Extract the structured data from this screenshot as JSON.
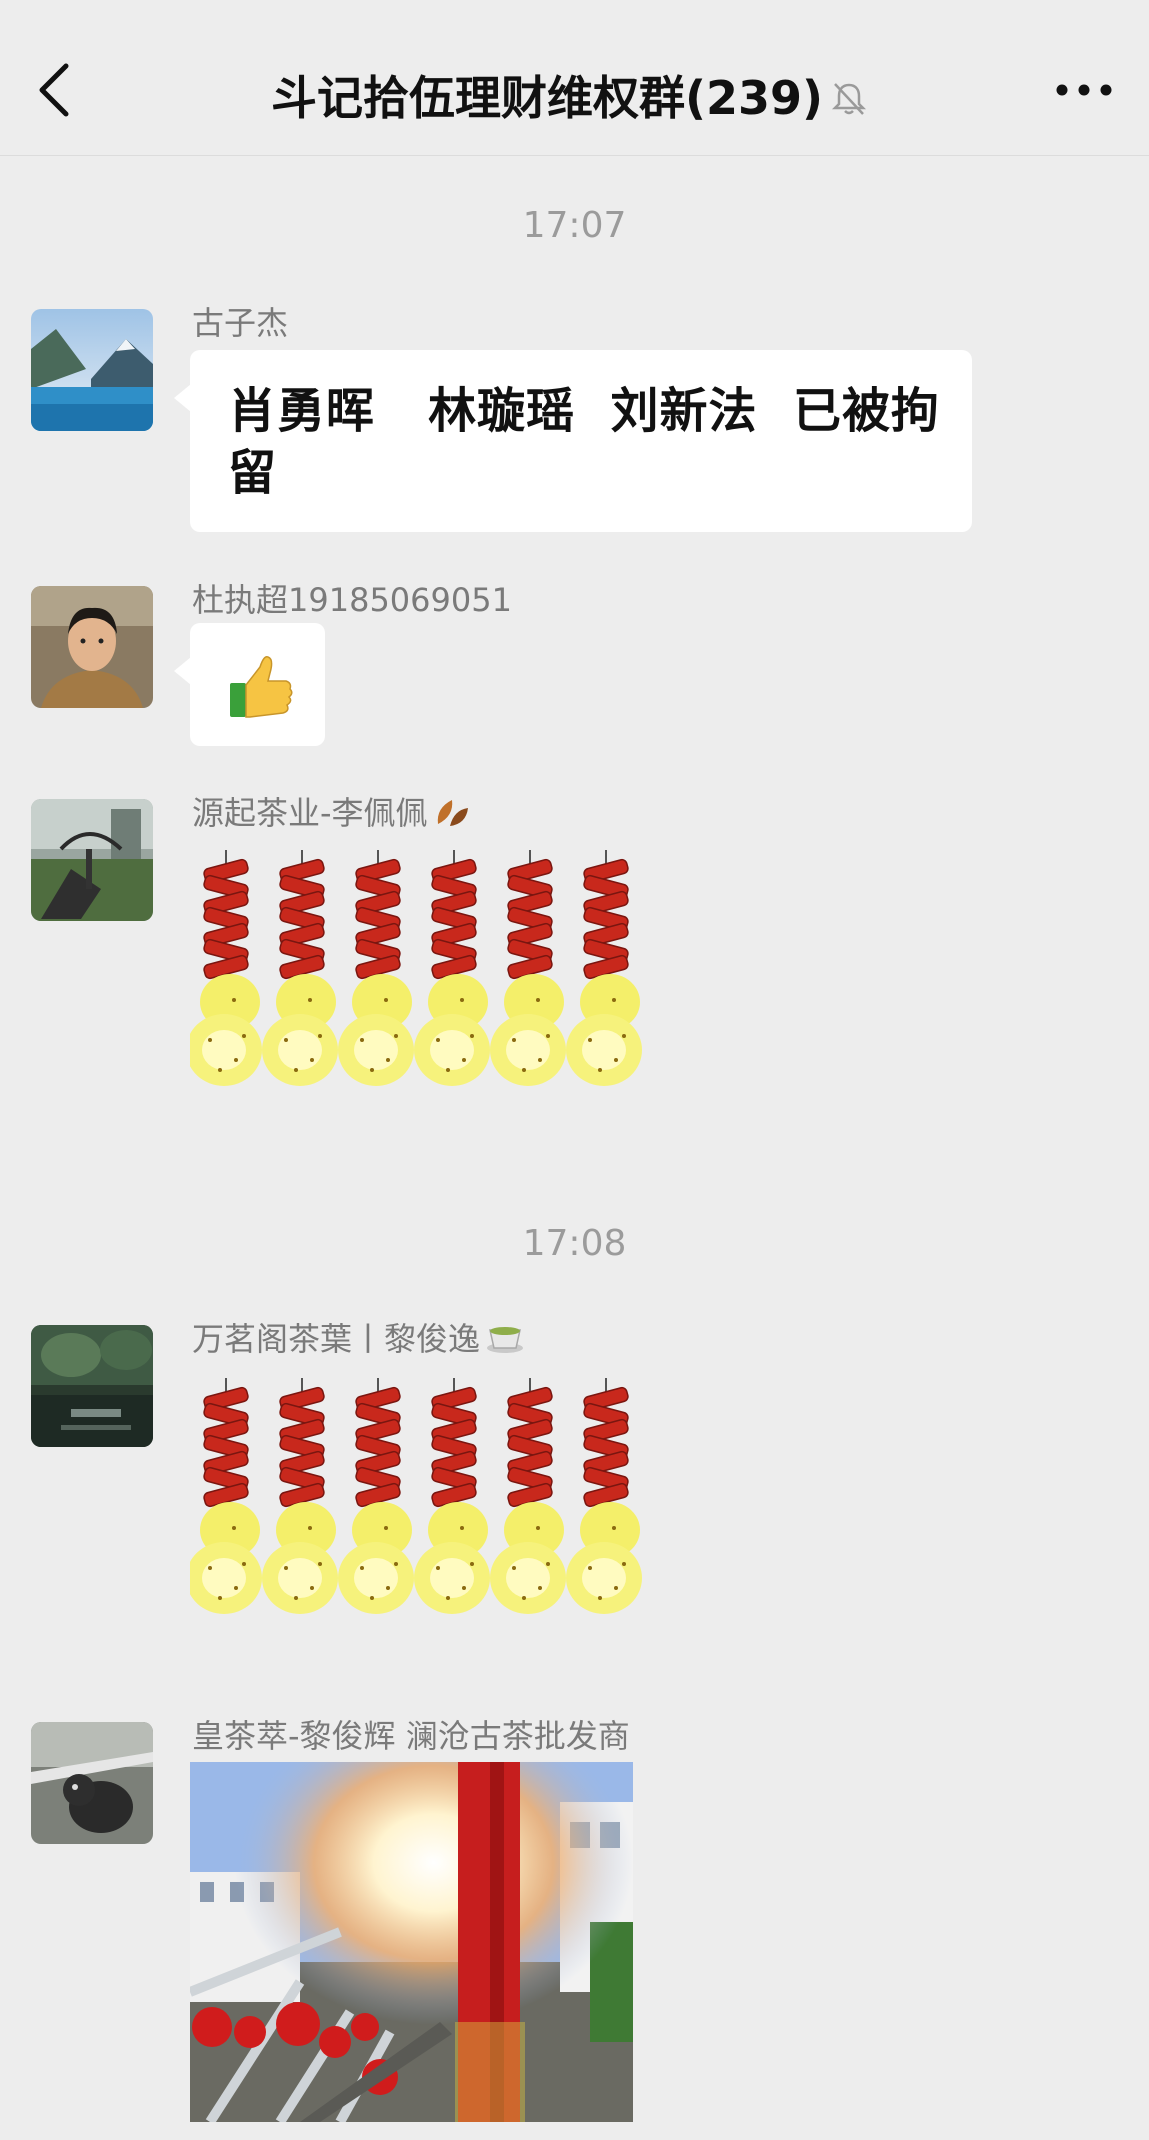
{
  "header": {
    "title": "斗记拾伍理财维权群(239)",
    "back_icon": "chevron-left-icon",
    "mute_icon": "bell-off-icon",
    "more_icon": "more-dots-icon"
  },
  "timestamps": [
    "17:07",
    "17:08"
  ],
  "messages": [
    {
      "sender": "古子杰",
      "text_line1": "肖勇晖   林璇瑶  刘新法  已被拘",
      "text_line2": "留"
    },
    {
      "sender": "杜执超19185069051",
      "emoji": "thumbs-up"
    },
    {
      "sender": "源起茶业-李佩佩",
      "sender_emoji": "fallen-leaves",
      "sticker": "firecrackers"
    },
    {
      "sender": "万茗阁茶葉丨黎俊逸",
      "sender_emoji": "tea-cup",
      "sticker": "firecrackers"
    },
    {
      "sender": "皇茶萃-黎俊辉 澜沧古茶批发商",
      "image": "firecracker-photo"
    }
  ],
  "colors": {
    "background": "#ededed",
    "bubble": "#ffffff",
    "timestamp": "#9b9b9b",
    "sender": "#7a7a7a"
  }
}
